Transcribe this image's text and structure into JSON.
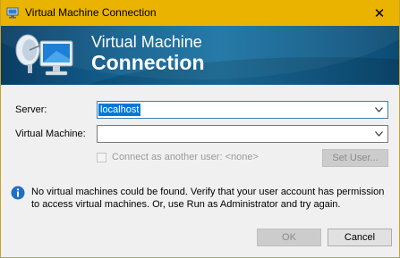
{
  "window": {
    "title": "Virtual Machine Connection",
    "close_glyph": "✕"
  },
  "banner": {
    "line1": "Virtual Machine",
    "line2": "Connection",
    "logo_icon": "monitor-satellite-icon"
  },
  "form": {
    "server_label": "Server:",
    "server_value": "localhost",
    "vm_label": "Virtual Machine:",
    "vm_value": "",
    "connect_as_label": "Connect as another user: <none>",
    "connect_as_checked": false,
    "set_user_label": "Set User..."
  },
  "message": {
    "icon": "info-icon",
    "text": "No virtual machines could be found. Verify that your user account has permission to access virtual machines. Or, use Run as Administrator and try again."
  },
  "buttons": {
    "ok_label": "OK",
    "cancel_label": "Cancel"
  },
  "colors": {
    "titlebar": "#e9b300",
    "banner": "#12608f",
    "selection": "#0078d7",
    "info": "#1f6fc5"
  }
}
